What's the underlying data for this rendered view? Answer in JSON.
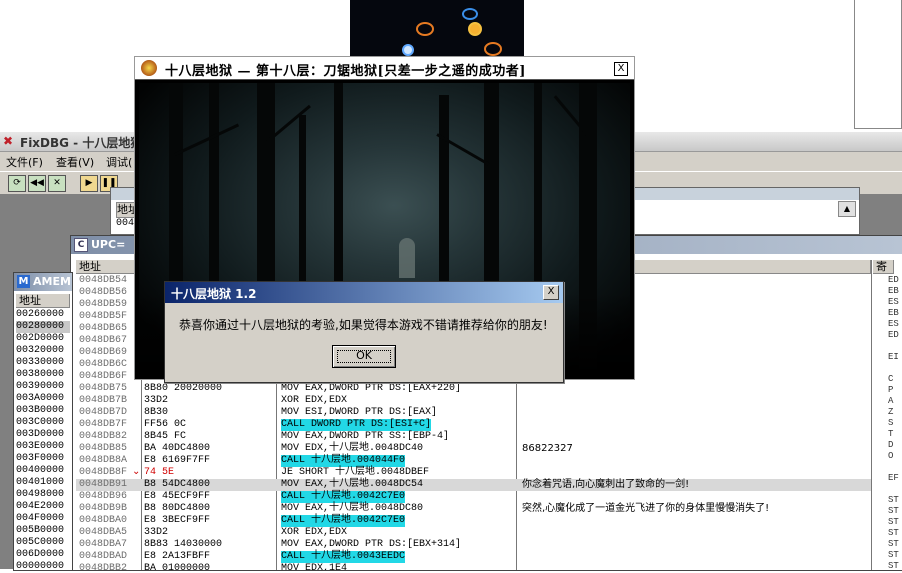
{
  "game_window": {
    "title": "十八层地狱 — 第十八层：刀锯地狱[只差一步之遥的成功者]",
    "close_glyph": "X"
  },
  "dialog": {
    "title": "十八层地狱 1.2",
    "message": "恭喜你通过十八层地狱的考验,如果觉得本游戏不错请推荐给你的朋友!",
    "ok_label": "OK",
    "close_glyph": "X"
  },
  "debugger": {
    "title": "FixDBG - 十八层地狱",
    "menu": [
      "文件(F)",
      "查看(V)",
      "调试("
    ],
    "toolbar_buttons": [
      "restart-icon",
      "rewind-icon",
      "close-icon",
      "run-icon",
      "pause-icon"
    ]
  },
  "window2": {
    "header": "地址",
    "row_addr": "004"
  },
  "cpu_window": {
    "title": "UPC= ",
    "col_address": "地址",
    "col_registers": "寄",
    "rows": [
      {
        "addr": "0048DB54",
        "hex": "",
        "ins": "",
        "com": ""
      },
      {
        "addr": "0048DB56",
        "hex": "",
        "ins": "",
        "com": ""
      },
      {
        "addr": "0048DB59",
        "hex": "",
        "ins": "",
        "com": ""
      },
      {
        "addr": "0048DB5F",
        "hex": "",
        "ins": "",
        "com": ""
      },
      {
        "addr": "0048DB65",
        "hex": "",
        "ins": "",
        "com": ""
      },
      {
        "addr": "0048DB67",
        "hex": "",
        "ins": "",
        "com": ""
      },
      {
        "addr": "0048DB69",
        "hex": "",
        "ins": "",
        "com": ""
      },
      {
        "addr": "0048DB6C",
        "hex": "",
        "ins": "",
        "com": ""
      },
      {
        "addr": "0048DB6F",
        "hex": "",
        "ins": "",
        "com": ""
      },
      {
        "addr": "0048DB75",
        "hex": "8B80 20020000",
        "ins": "MOV EAX,DWORD PTR DS:[EAX+220]",
        "com": ""
      },
      {
        "addr": "0048DB7B",
        "hex": "33D2",
        "ins": "XOR EDX,EDX",
        "com": ""
      },
      {
        "addr": "0048DB7D",
        "hex": "8B30",
        "ins": "MOV ESI,DWORD PTR DS:[EAX]",
        "com": ""
      },
      {
        "addr": "0048DB7F",
        "hex": "FF56 0C",
        "ins": "CALL DWORD PTR DS:[ESI+C]",
        "com": "",
        "hl": true
      },
      {
        "addr": "0048DB82",
        "hex": "8B45 FC",
        "ins": "MOV EAX,DWORD PTR SS:[EBP-4]",
        "com": ""
      },
      {
        "addr": "0048DB85",
        "hex": "BA 40DC4800",
        "ins": "MOV EDX,十八层地.0048DC40",
        "com": "86822327"
      },
      {
        "addr": "0048DB8A",
        "hex": "E8 6169F7FF",
        "ins": "CALL 十八层地.004044F0",
        "com": "",
        "hl": true
      },
      {
        "addr": "0048DB8F",
        "hex": "74 5E",
        "ins": "JE SHORT 十八层地.0048DBEF",
        "com": "",
        "mark": "⌄",
        "red": true
      },
      {
        "addr": "0048DB91",
        "hex": "B8 54DC4800",
        "ins": "MOV EAX,十八层地.0048DC54",
        "com": "你念着咒语,向心魔刺出了致命的一剑!",
        "sel": true
      },
      {
        "addr": "0048DB96",
        "hex": "E8 45ECF9FF",
        "ins": "CALL 十八层地.0042C7E0",
        "com": "",
        "hl": true
      },
      {
        "addr": "0048DB9B",
        "hex": "B8 80DC4800",
        "ins": "MOV EAX,十八层地.0048DC80",
        "com": "突然,心魔化成了一道金光飞进了你的身体里慢慢消失了!"
      },
      {
        "addr": "0048DBA0",
        "hex": "E8 3BECF9FF",
        "ins": "CALL 十八层地.0042C7E0",
        "com": "",
        "hl": true
      },
      {
        "addr": "0048DBA5",
        "hex": "33D2",
        "ins": "XOR EDX,EDX",
        "com": ""
      },
      {
        "addr": "0048DBA7",
        "hex": "8B83 14030000",
        "ins": "MOV EAX,DWORD PTR DS:[EBX+314]",
        "com": ""
      },
      {
        "addr": "0048DBAD",
        "hex": "E8 2A13FBFF",
        "ins": "CALL 十八层地.0043EEDC",
        "com": "",
        "hl": true
      },
      {
        "addr": "0048DBB2",
        "hex": "BA 01000000",
        "ins": "MOV EDX,1E4",
        "com": ""
      }
    ],
    "reg_labels": [
      "ED",
      "EB",
      "ES",
      "EB",
      "ES",
      "ED",
      "",
      "EI",
      "",
      "C",
      "P",
      "A",
      "Z",
      "S",
      "T",
      "D",
      "O",
      "",
      "EF",
      "",
      "ST",
      "ST",
      "ST",
      "ST",
      "ST",
      "ST",
      "ST"
    ]
  },
  "memory_window": {
    "title": "AMEM",
    "badge": "M",
    "col_address": "地址",
    "rows": [
      "00260000",
      "00280000",
      "002D0000",
      "00320000",
      "00330000",
      "00380000",
      "00390000",
      "003A0000",
      "003B0000",
      "003C0000",
      "003D0000",
      "003E0000",
      "003F0000",
      "00400000",
      "00401000",
      "00498000",
      "004E2000",
      "004F0000",
      "005B0000",
      "005C0000",
      "006D0000",
      "00000000"
    ],
    "highlight_index": 1
  }
}
